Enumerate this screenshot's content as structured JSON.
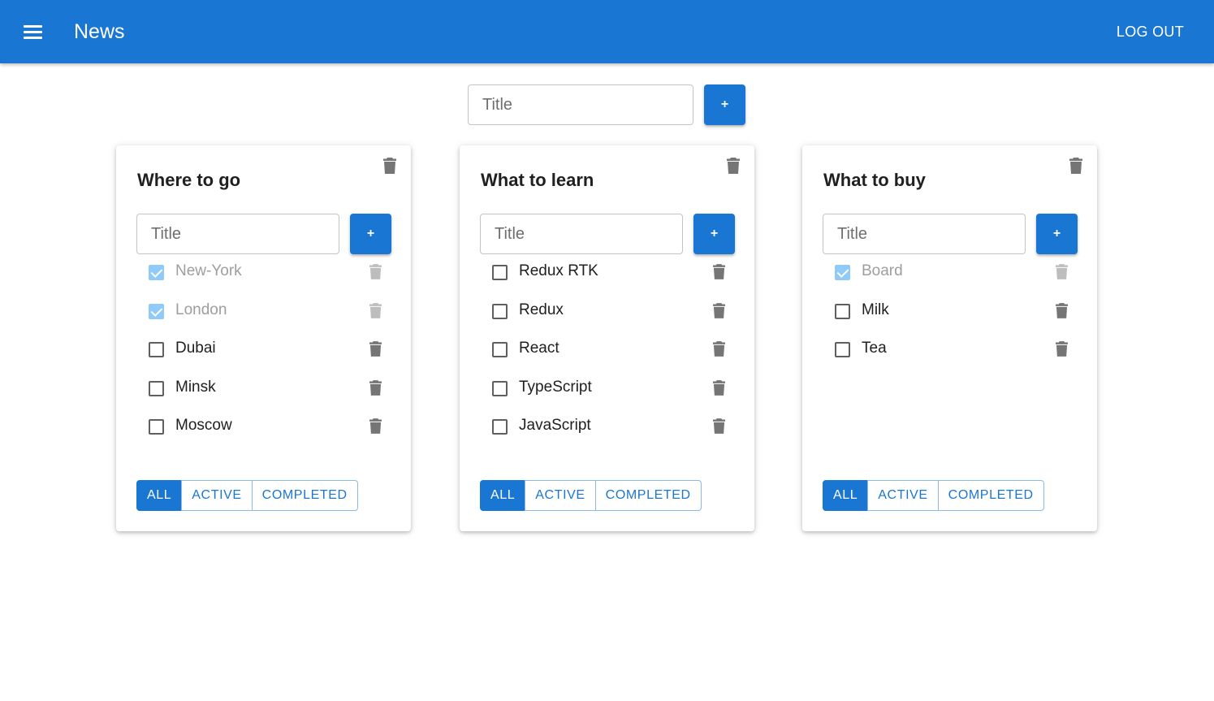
{
  "app": {
    "title": "News",
    "logout_label": "LOG OUT",
    "accent_color": "#1976d2"
  },
  "new_list": {
    "placeholder": "Title",
    "add_label": "+"
  },
  "todolists": [
    {
      "title": "Where to go",
      "input_placeholder": "Title",
      "add_label": "+",
      "tasks": [
        {
          "label": "New-York",
          "checked": true
        },
        {
          "label": "London",
          "checked": true
        },
        {
          "label": "Dubai",
          "checked": false
        },
        {
          "label": "Minsk",
          "checked": false
        },
        {
          "label": "Moscow",
          "checked": false
        }
      ],
      "filters": [
        {
          "label": "ALL",
          "active": true
        },
        {
          "label": "ACTIVE",
          "active": false
        },
        {
          "label": "COMPLETED",
          "active": false
        }
      ]
    },
    {
      "title": "What to learn",
      "input_placeholder": "Title",
      "add_label": "+",
      "tasks": [
        {
          "label": "Redux RTK",
          "checked": false
        },
        {
          "label": "Redux",
          "checked": false
        },
        {
          "label": "React",
          "checked": false
        },
        {
          "label": "TypeScript",
          "checked": false
        },
        {
          "label": "JavaScript",
          "checked": false
        }
      ],
      "filters": [
        {
          "label": "ALL",
          "active": true
        },
        {
          "label": "ACTIVE",
          "active": false
        },
        {
          "label": "COMPLETED",
          "active": false
        }
      ]
    },
    {
      "title": "What to buy",
      "input_placeholder": "Title",
      "add_label": "+",
      "tasks": [
        {
          "label": "Board",
          "checked": true
        },
        {
          "label": "Milk",
          "checked": false
        },
        {
          "label": "Tea",
          "checked": false
        }
      ],
      "filters": [
        {
          "label": "ALL",
          "active": true
        },
        {
          "label": "ACTIVE",
          "active": false
        },
        {
          "label": "COMPLETED",
          "active": false
        }
      ]
    }
  ]
}
